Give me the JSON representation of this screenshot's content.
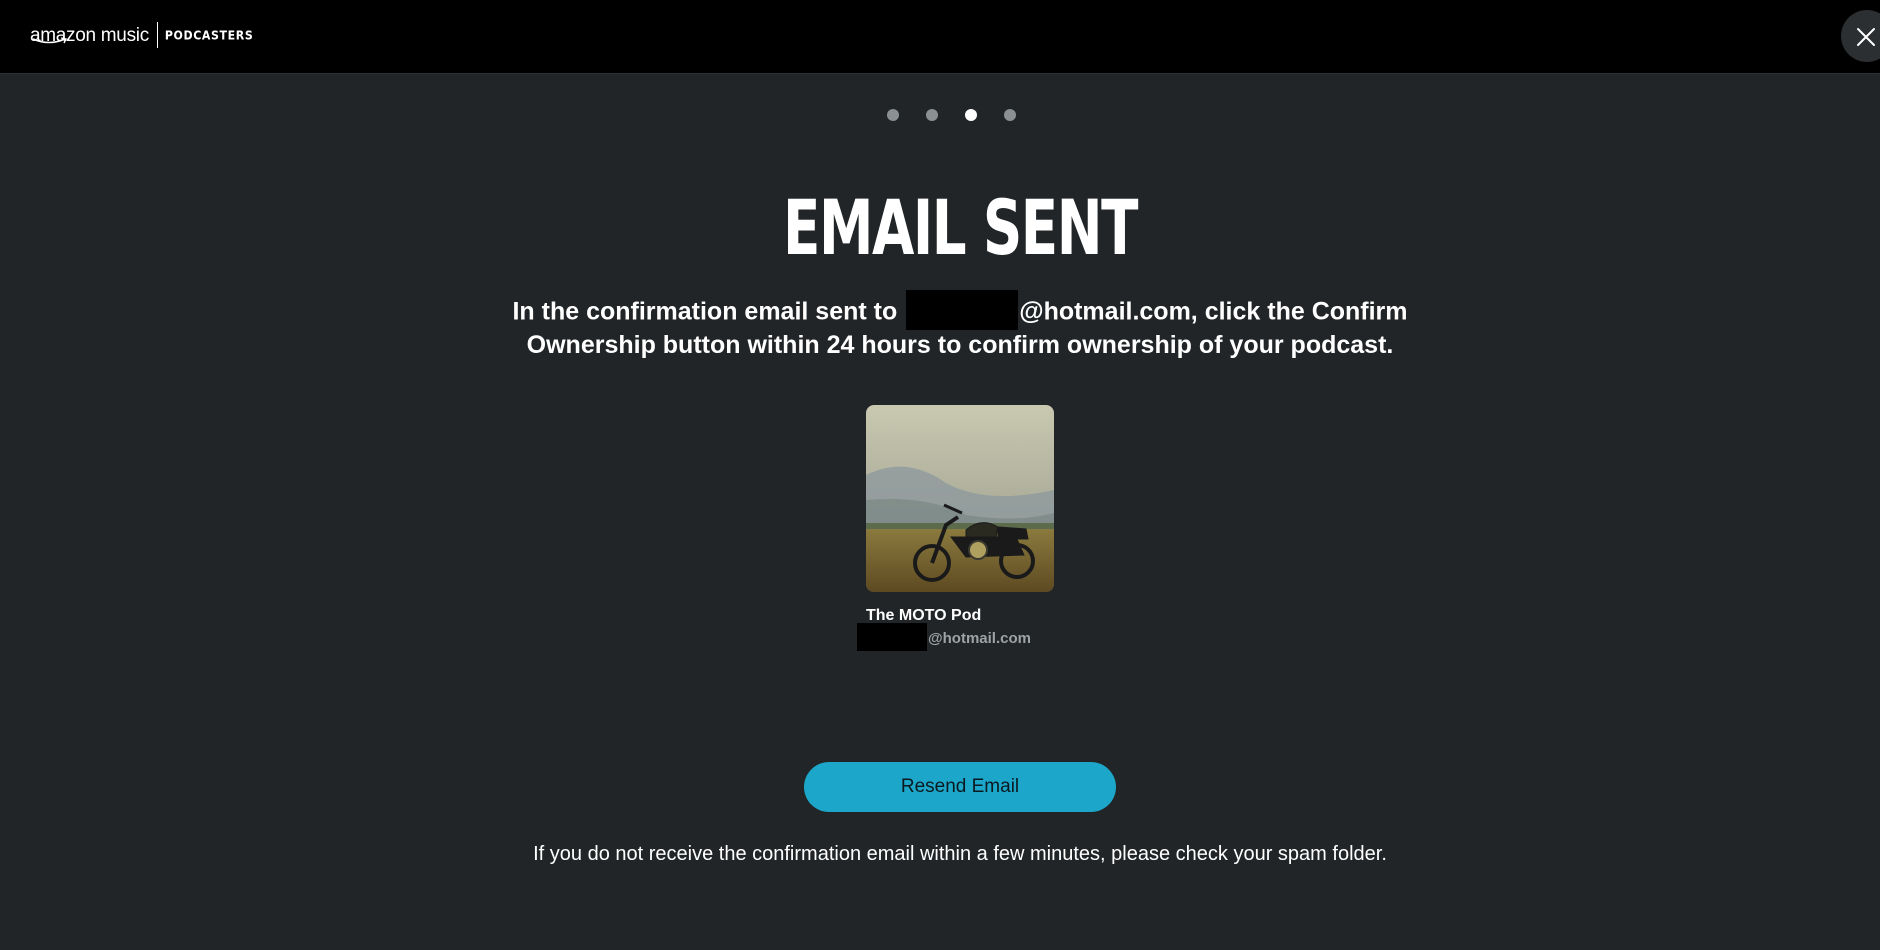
{
  "header": {
    "brand_name": "amazon music",
    "brand_sub": "PODCASTERS",
    "close_icon": "close-icon"
  },
  "steps": {
    "count": 4,
    "current": 3
  },
  "main": {
    "title": "EMAIL SENT",
    "message_prefix": "In the confirmation email sent to",
    "message_suffix": "@hotmail.com, click the Confirm Ownership button within 24 hours to confirm ownership of your podcast."
  },
  "podcast": {
    "name": "The MOTO Pod",
    "email_domain": "@hotmail.com",
    "cover_icon": "motorcycle-image"
  },
  "actions": {
    "resend_label": "Resend Email"
  },
  "footer": {
    "note": "If you do not receive the confirmation email within a few minutes, please check your spam folder."
  },
  "colors": {
    "background": "#212527",
    "header": "#000000",
    "accent": "#1ca6c9",
    "muted_text": "#9ea3a6"
  }
}
